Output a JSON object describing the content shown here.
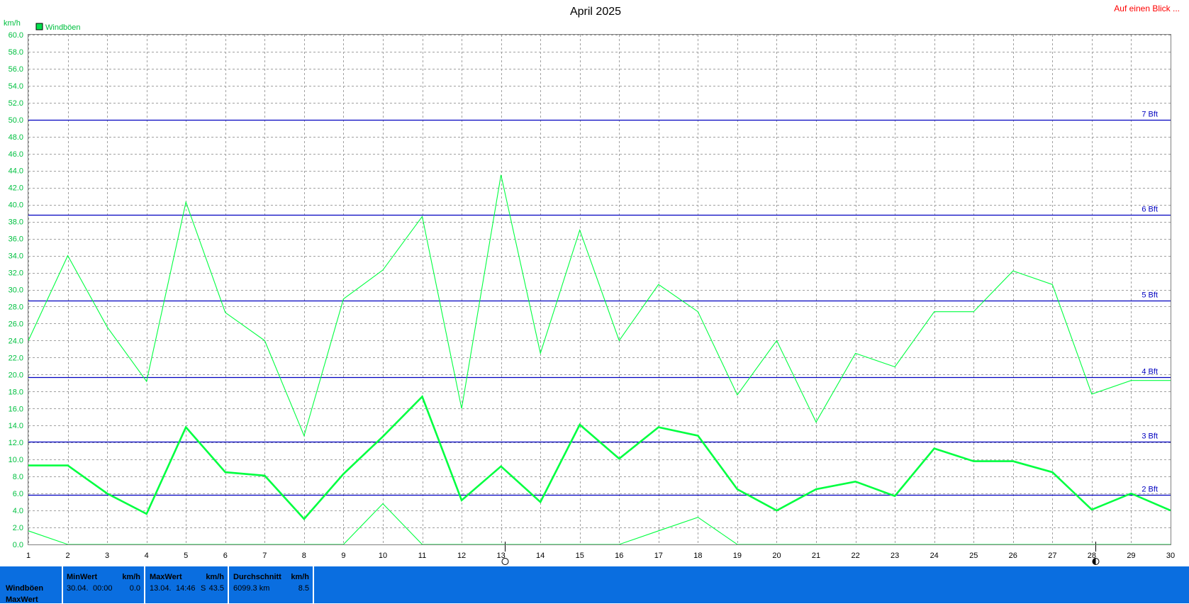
{
  "header": {
    "title": "April 2025",
    "link": "Auf einen Blick ...",
    "unit": "km/h",
    "legend": "Windböen"
  },
  "colors": {
    "series": "#00ff40",
    "series_legend_box": "#00e04c",
    "beaufort_lines": "#0000c0",
    "link": "#ff0000",
    "footer_bg": "#0a6ee0"
  },
  "chart_data": {
    "type": "line",
    "title": "April 2025",
    "ylabel": "km/h",
    "ylim": [
      0,
      60
    ],
    "yticks": [
      "0.0",
      "2.0",
      "4.0",
      "6.0",
      "8.0",
      "10.0",
      "12.0",
      "14.0",
      "16.0",
      "18.0",
      "20.0",
      "22.0",
      "24.0",
      "26.0",
      "28.0",
      "30.0",
      "32.0",
      "34.0",
      "36.0",
      "38.0",
      "40.0",
      "42.0",
      "44.0",
      "46.0",
      "48.0",
      "50.0",
      "52.0",
      "54.0",
      "56.0",
      "58.0",
      "60.0"
    ],
    "x": [
      "1",
      "2",
      "3",
      "4",
      "5",
      "6",
      "7",
      "8",
      "9",
      "10",
      "11",
      "12",
      "13",
      "14",
      "15",
      "16",
      "17",
      "18",
      "19",
      "20",
      "21",
      "22",
      "23",
      "24",
      "25",
      "26",
      "27",
      "28",
      "29",
      "30"
    ],
    "grid": true,
    "legend_position": "top-left",
    "series": [
      {
        "name": "Windböen",
        "role": "max",
        "values": [
          24.0,
          34.0,
          25.6,
          19.2,
          40.3,
          27.3,
          24.0,
          12.8,
          28.9,
          32.3,
          38.6,
          16.0,
          43.5,
          22.5,
          37.0,
          24.0,
          30.6,
          27.4,
          17.6,
          24.0,
          14.4,
          22.5,
          20.9,
          27.4,
          27.4,
          32.2,
          30.6,
          17.7,
          19.3,
          19.3
        ]
      },
      {
        "name": "Windböen",
        "role": "average",
        "values": [
          9.3,
          9.3,
          6.0,
          3.6,
          13.8,
          8.5,
          8.1,
          3.0,
          8.3,
          12.7,
          17.4,
          5.2,
          9.2,
          5.0,
          14.1,
          10.1,
          13.8,
          12.8,
          6.5,
          4.0,
          6.5,
          7.4,
          5.7,
          11.3,
          9.8,
          9.8,
          8.5,
          4.1,
          6.0,
          4.0
        ]
      },
      {
        "name": "Windböen",
        "role": "min",
        "values": [
          1.6,
          0.0,
          0.0,
          0.0,
          0.0,
          0.0,
          0.0,
          0.0,
          0.0,
          4.8,
          0.0,
          0.0,
          0.0,
          0.0,
          0.0,
          0.0,
          1.6,
          3.2,
          0.0,
          0.0,
          0.0,
          0.0,
          0.0,
          0.0,
          0.0,
          0.0,
          0.0,
          0.0,
          0.0,
          0.0
        ]
      }
    ],
    "reference_lines": [
      {
        "label": "2 Bft",
        "value": 5.8
      },
      {
        "label": "3 Bft",
        "value": 12.1
      },
      {
        "label": "4 Bft",
        "value": 19.7
      },
      {
        "label": "5 Bft",
        "value": 28.7
      },
      {
        "label": "6 Bft",
        "value": 38.8
      },
      {
        "label": "7 Bft",
        "value": 50.0
      }
    ],
    "moon_markers": [
      {
        "day": "13",
        "phase": "full"
      },
      {
        "day": "28",
        "phase": "new"
      }
    ]
  },
  "stats": {
    "row_label": "Windböen",
    "row_label2": "MaxWert",
    "min": {
      "header": "MinWert",
      "unit": "km/h",
      "date": "30.04.",
      "time": "00:00",
      "value": "0.0"
    },
    "max": {
      "header": "MaxWert",
      "unit": "km/h",
      "date": "13.04.",
      "time": "14:46",
      "dir": "S",
      "value": "43.5"
    },
    "avg": {
      "header": "Durchschnitt",
      "unit": "km/h",
      "distance": "6099.3 km",
      "value": "8.5"
    }
  }
}
